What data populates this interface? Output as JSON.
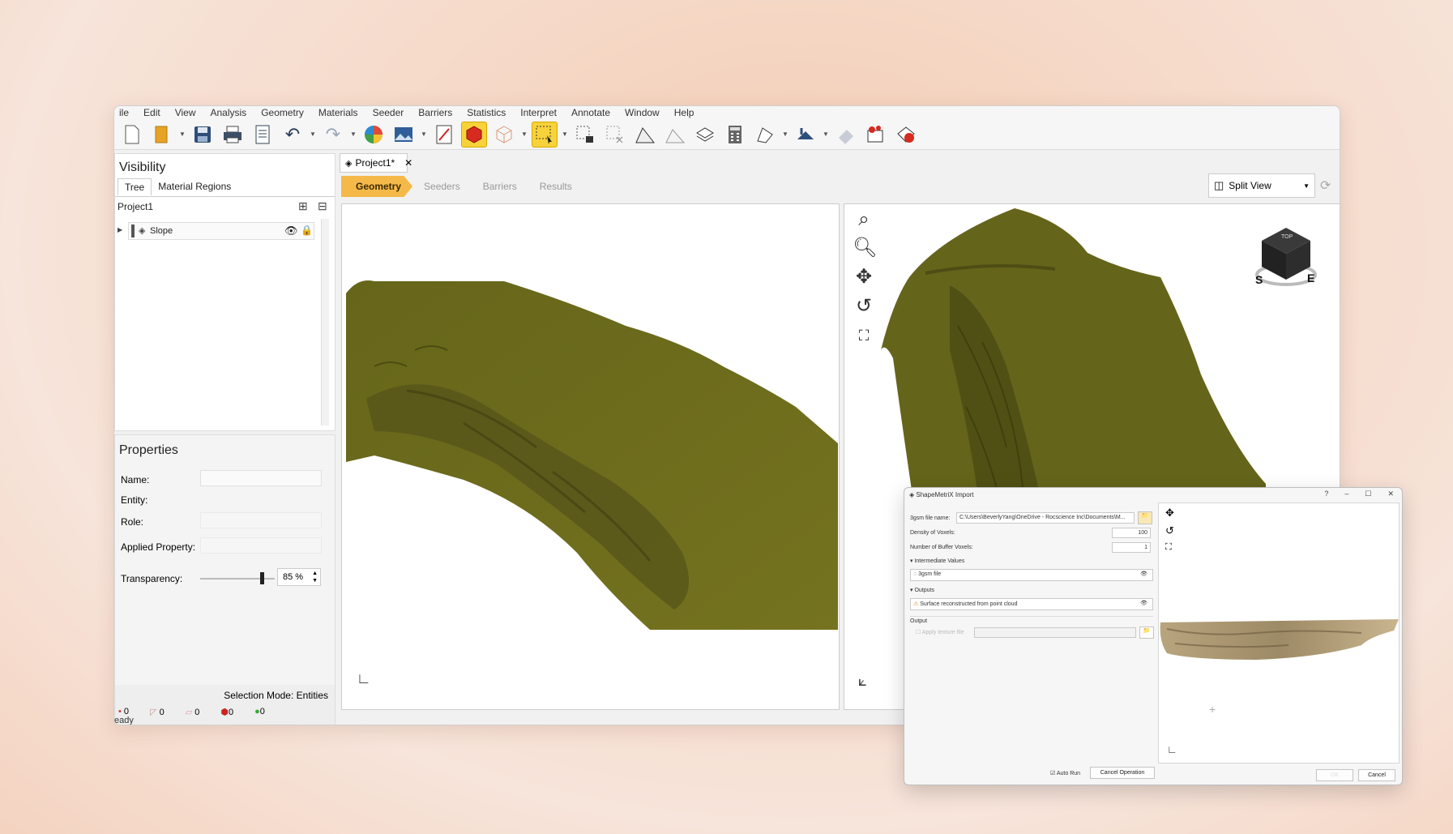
{
  "menu": [
    "ile",
    "Edit",
    "View",
    "Analysis",
    "Geometry",
    "Materials",
    "Seeder",
    "Barriers",
    "Statistics",
    "Interpret",
    "Annotate",
    "Window",
    "Help"
  ],
  "visibility": {
    "title": "Visibility",
    "tabs": [
      "Tree",
      "Material Regions"
    ],
    "project": "Project1",
    "tree_item": "Slope"
  },
  "properties": {
    "title": "Properties",
    "name_label": "Name:",
    "entity_label": "Entity:",
    "role_label": "Role:",
    "applied_label": "Applied Property:",
    "transparency_label": "Transparency:",
    "transparency_value": "85 %",
    "transparency_level": 0.85
  },
  "selection_mode": "Selection Mode: Entities",
  "counters": [
    "0",
    "0",
    "0",
    "0",
    "0"
  ],
  "status_text": "eady",
  "document_tab": "Project1*",
  "workflow": [
    "Geometry",
    "Seeders",
    "Barriers",
    "Results"
  ],
  "split_view": "Split View",
  "view_cube": {
    "top": "TOP",
    "left": "S",
    "right": "E"
  },
  "colors": {
    "terrain": "#6b6a1d",
    "terrain_dark": "#4f4e12",
    "accent": "#f5b94a"
  },
  "dialog": {
    "title": "ShapeMetriX Import",
    "file_label": "3gsm file name:",
    "file_value": "C:\\Users\\BeverlyYang\\OneDrive - Rocscience Inc\\Documents\\M...",
    "density_label": "Density of Voxels:",
    "density_value": "100",
    "buffer_label": "Number of Buffer Voxels:",
    "buffer_value": "1",
    "intermediate_label": "Intermediate Values",
    "intermediate_item": "3gsm file",
    "outputs_label": "Outputs",
    "outputs_item": "Surface reconstructed from point cloud",
    "output_section": "Output",
    "apply_texture": "Apply texture file",
    "auto_run": "Auto Run",
    "cancel_op": "Cancel Operation",
    "ok": "OK",
    "cancel": "Cancel"
  }
}
